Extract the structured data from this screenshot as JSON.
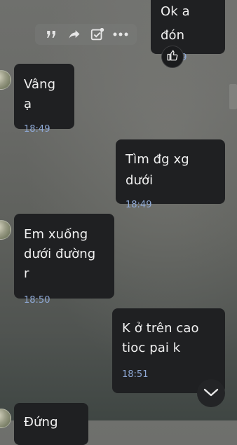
{
  "messages": [
    {
      "direction": "outgoing",
      "text": "Ok a đón",
      "time": "18:49",
      "reaction": "thumbs-up"
    },
    {
      "direction": "incoming",
      "text": "Vâng ạ",
      "time": "18:49"
    },
    {
      "direction": "outgoing",
      "text": "Tìm đg xg dưới",
      "time": "18:49"
    },
    {
      "direction": "incoming",
      "text_lines": [
        "Em xuống",
        "dưới đường r"
      ],
      "time": "18:50"
    },
    {
      "direction": "outgoing",
      "text_lines": [
        "K ở trên cao",
        "tioc pai k"
      ],
      "time": "18:51"
    },
    {
      "direction": "incoming",
      "text": "Đứng",
      "time": ""
    }
  ],
  "toolbar": {
    "icons": [
      "quote-icon",
      "forward-icon",
      "check-icon",
      "more-icon"
    ]
  },
  "colors": {
    "bubble": "#1f2022",
    "time": "#8fa9d6",
    "text": "#f1f1f1"
  }
}
